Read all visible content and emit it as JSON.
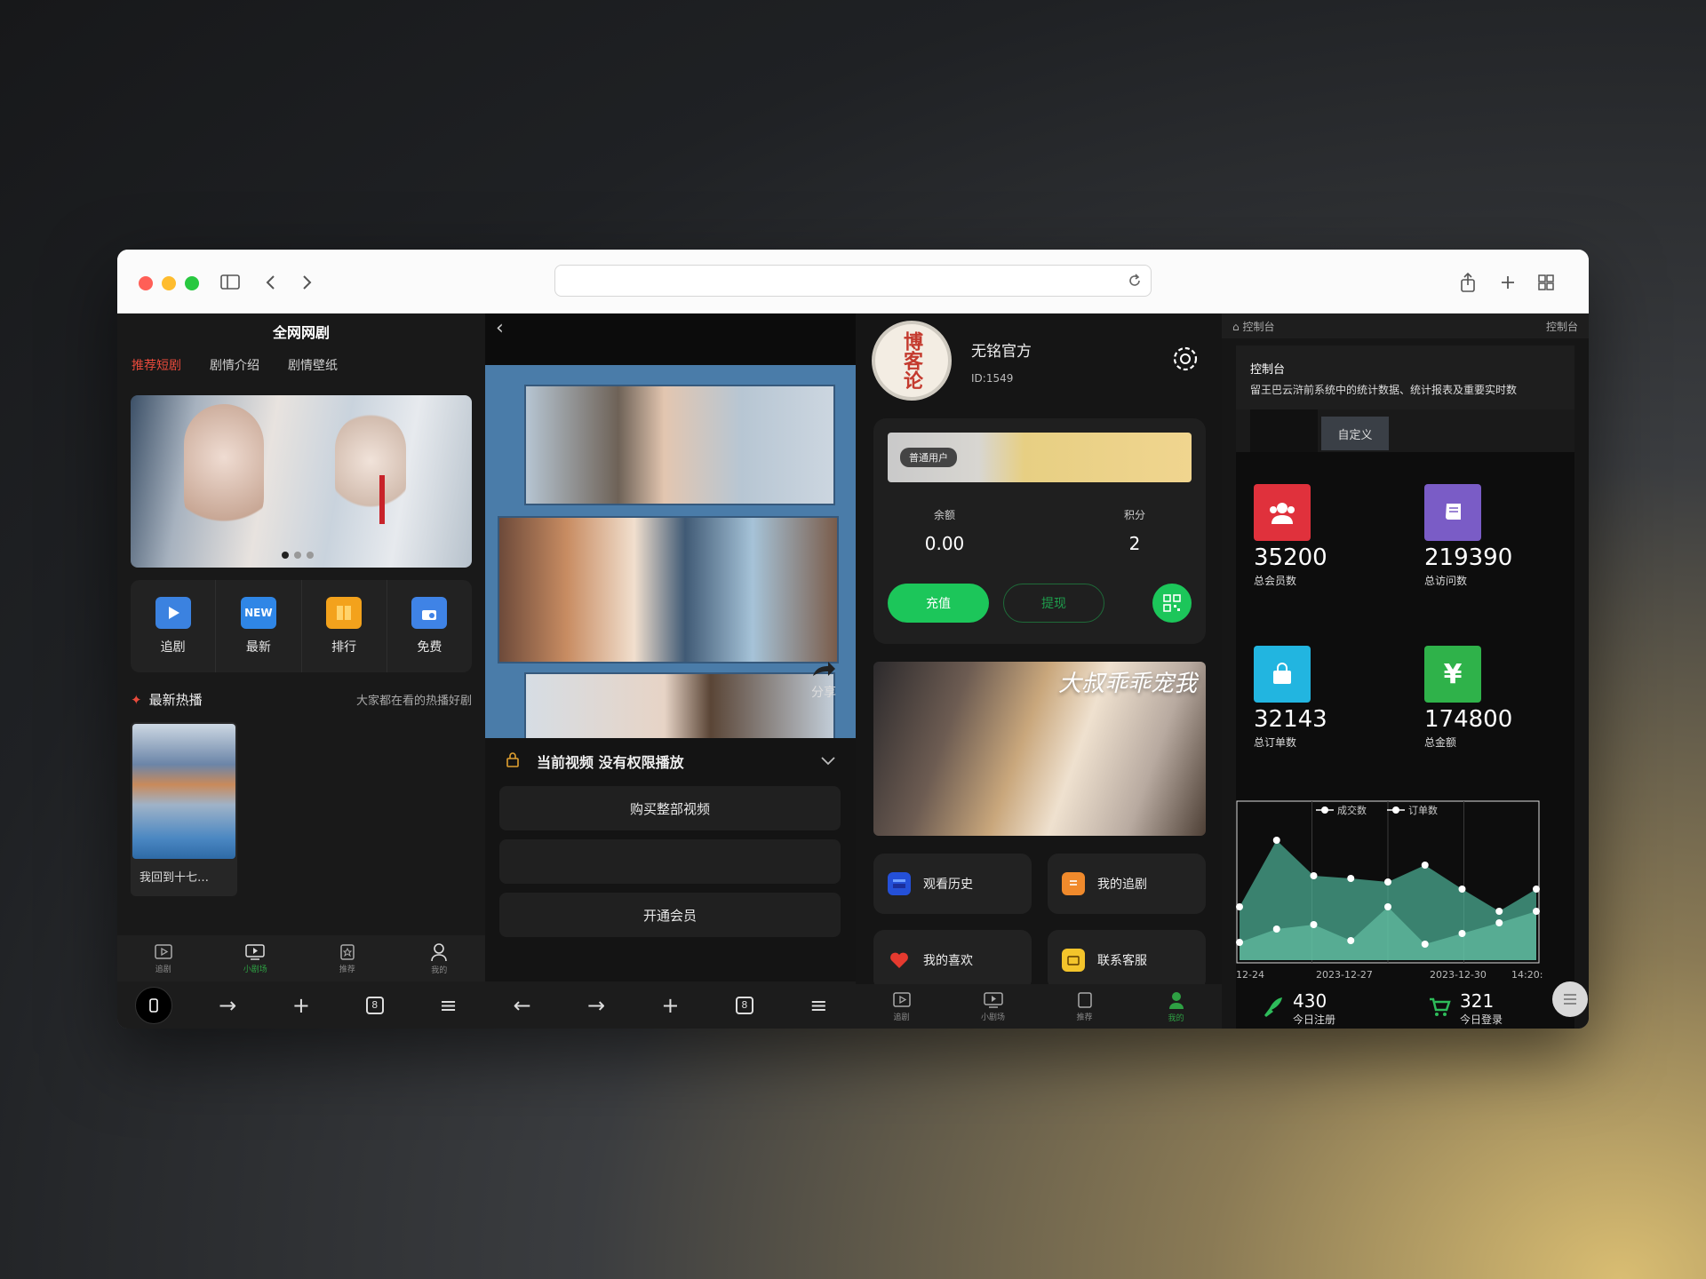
{
  "browser": {
    "url": ""
  },
  "panel1": {
    "title": "全网网剧",
    "tabs": [
      "推荐短剧",
      "剧情介绍",
      "剧情壁纸"
    ],
    "quick": [
      {
        "label": "追剧",
        "icon": "play-icon",
        "color": "#3b82e0"
      },
      {
        "label": "最新",
        "icon": "new-icon",
        "color": "#2f86e6"
      },
      {
        "label": "排行",
        "icon": "book-icon",
        "color": "#f3a21c"
      },
      {
        "label": "免费",
        "icon": "gift-icon",
        "color": "#3f83e6"
      }
    ],
    "new_badge": "NEW",
    "section_title": "最新热播",
    "section_sub": "大家都在看的热播好剧",
    "card_caption": "我回到十七…",
    "nav": [
      "追剧",
      "小剧场",
      "推荐",
      "我的"
    ]
  },
  "panel2": {
    "share": "分享",
    "lock_text": "当前视频 没有权限播放",
    "buy_label": "购买整部视频",
    "empty_label": "",
    "vip_label": "开通会员"
  },
  "panel3": {
    "username": "无铭官方",
    "user_id": "ID:1549",
    "avatar_text": "博客论",
    "vip_tag": "普通用户",
    "balance_label": "余额",
    "balance": "0.00",
    "points_label": "积分",
    "points": "2",
    "recharge": "充值",
    "withdraw": "提现",
    "promo_title": "大叔乖乖宠我",
    "menu": [
      "观看历史",
      "我的追剧",
      "我的喜欢",
      "联系客服"
    ],
    "nav": [
      "追剧",
      "小剧场",
      "推荐",
      "我的"
    ]
  },
  "panel4": {
    "top_left": "控制台",
    "top_right": "控制台",
    "info_title": "控制台",
    "info_sub": "留王巴云浒前系统中的统计数据、统计报表及重要实时数",
    "tab_custom": "自定义",
    "kpis": [
      {
        "value": "35200",
        "label": "总会员数",
        "color": "#e0313c"
      },
      {
        "value": "219390",
        "label": "总访问数",
        "color": "#7a5cc6"
      },
      {
        "value": "32143",
        "label": "总订单数",
        "color": "#22b5e0"
      },
      {
        "value": "174800",
        "label": "总金额",
        "color": "#2fb24a"
      }
    ],
    "chart_data": {
      "type": "area",
      "legend": [
        "成交数",
        "订单数"
      ],
      "x": [
        "12-24",
        "2023-12-27",
        "2023-12-30",
        "14:20:"
      ],
      "series": [
        {
          "name": "成交数",
          "values": [
            60,
            135,
            95,
            92,
            88,
            107,
            80,
            55,
            80
          ]
        },
        {
          "name": "订单数",
          "values": [
            20,
            35,
            40,
            22,
            60,
            18,
            30,
            42,
            55
          ]
        }
      ]
    },
    "today_register": "430",
    "today_register_label": "今日注册",
    "today_login": "321",
    "today_login_label": "今日登录"
  }
}
